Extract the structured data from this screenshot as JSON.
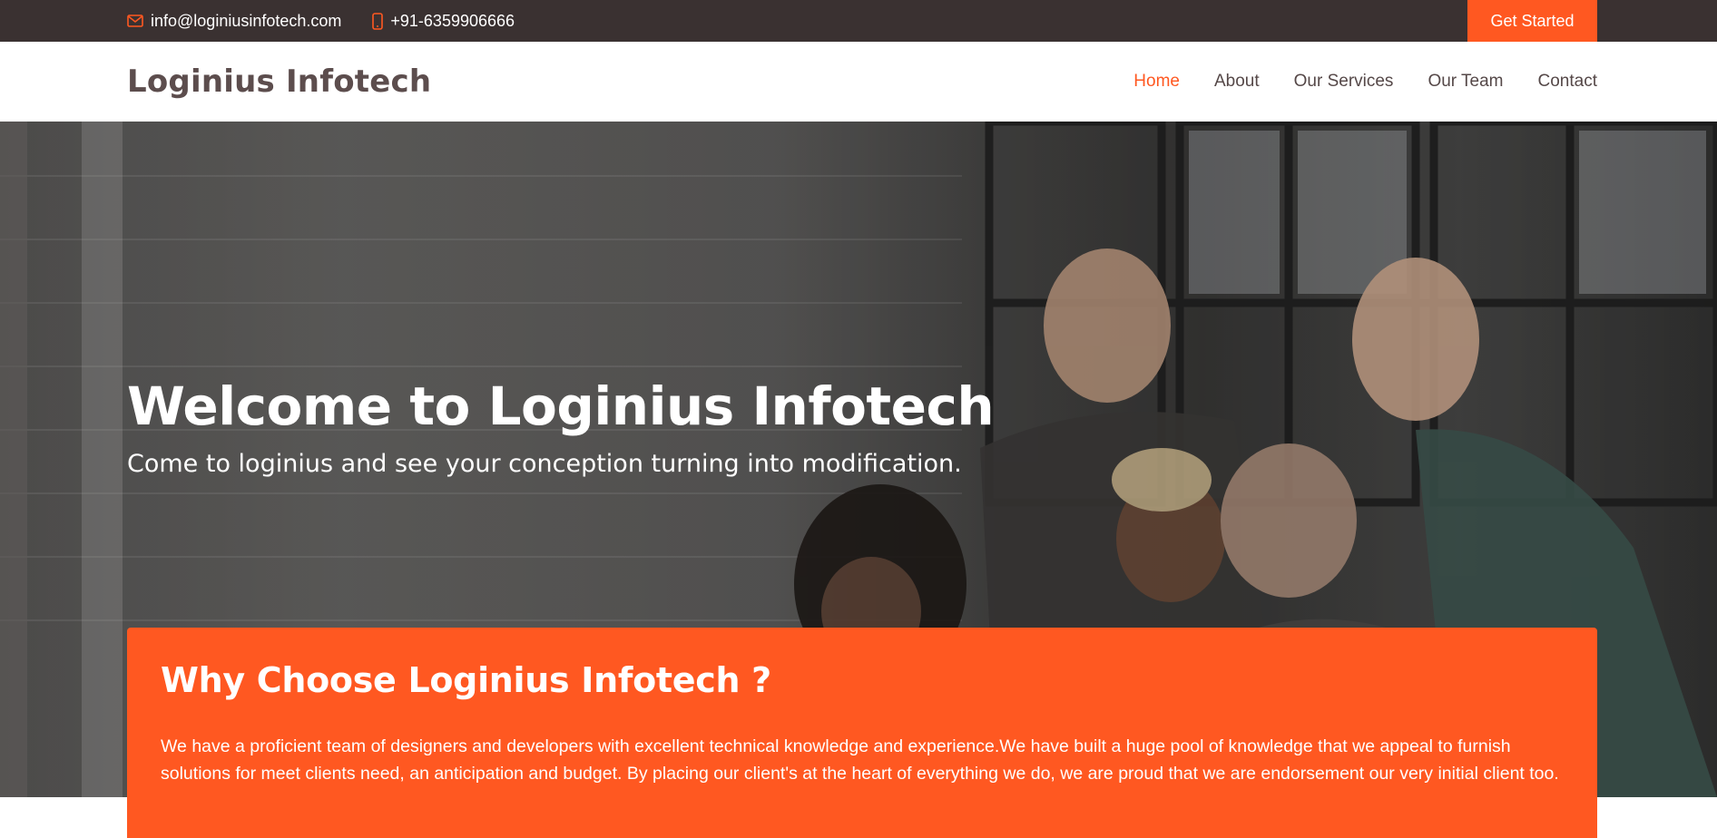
{
  "topbar": {
    "email": "info@loginiusinfotech.com",
    "phone": "+91-6359906666",
    "email_icon": "envelope-icon",
    "phone_icon": "mobile-phone-icon",
    "cta_label": "Get Started"
  },
  "header": {
    "logo": "Loginius Infotech",
    "nav": [
      {
        "label": "Home",
        "active": true
      },
      {
        "label": "About",
        "active": false
      },
      {
        "label": "Our Services",
        "active": false
      },
      {
        "label": "Our Team",
        "active": false
      },
      {
        "label": "Contact",
        "active": false
      }
    ]
  },
  "hero": {
    "title": "Welcome to Loginius Infotech",
    "subtitle": "Come to loginius and see your conception turning into modification."
  },
  "why": {
    "title": "Why Choose Loginius Infotech ?",
    "text": "We have a proficient team of designers and developers with excellent technical knowledge and experience.We have built a huge pool of knowledge that we appeal to furnish solutions for meet clients need, an anticipation and budget. By placing our client's at the heart of everything we do, we are proud that we are endorsement our very initial client too."
  },
  "colors": {
    "accent": "#ff5821",
    "topbar": "#3a3131",
    "logo": "#5c4d4d"
  }
}
